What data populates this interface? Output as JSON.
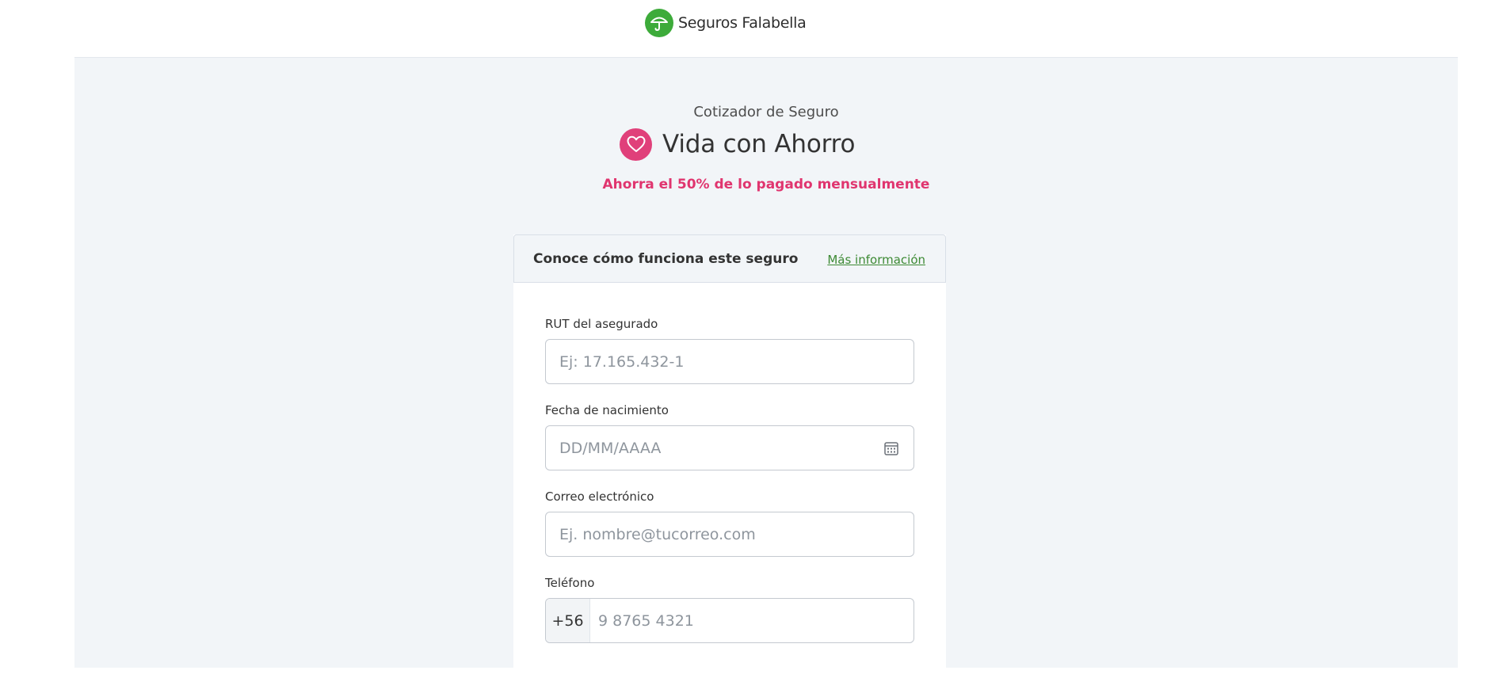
{
  "header": {
    "brand_name": "Seguros Falabella",
    "logo_icon": "umbrella-icon",
    "brand_color": "#3dab3a"
  },
  "hero": {
    "subtitle": "Cotizador de Seguro",
    "product_title": "Vida con Ahorro",
    "product_icon": "heart-icon",
    "tagline": "Ahorra el 50% de lo pagado mensualmente",
    "accent_color": "#e0407a"
  },
  "info_bar": {
    "text": "Conoce cómo funciona este seguro",
    "link_label": "Más información"
  },
  "form": {
    "rut": {
      "label": "RUT del asegurado",
      "placeholder": "Ej: 17.165.432-1",
      "value": ""
    },
    "birthdate": {
      "label": "Fecha de nacimiento",
      "placeholder": "DD/MM/AAAA",
      "value": "",
      "icon": "calendar-icon"
    },
    "email": {
      "label": "Correo electrónico",
      "placeholder": "Ej. nombre@tucorreo.com",
      "value": ""
    },
    "phone": {
      "label": "Teléfono",
      "prefix": "+56",
      "placeholder": "9 8765 4321",
      "value": ""
    }
  }
}
